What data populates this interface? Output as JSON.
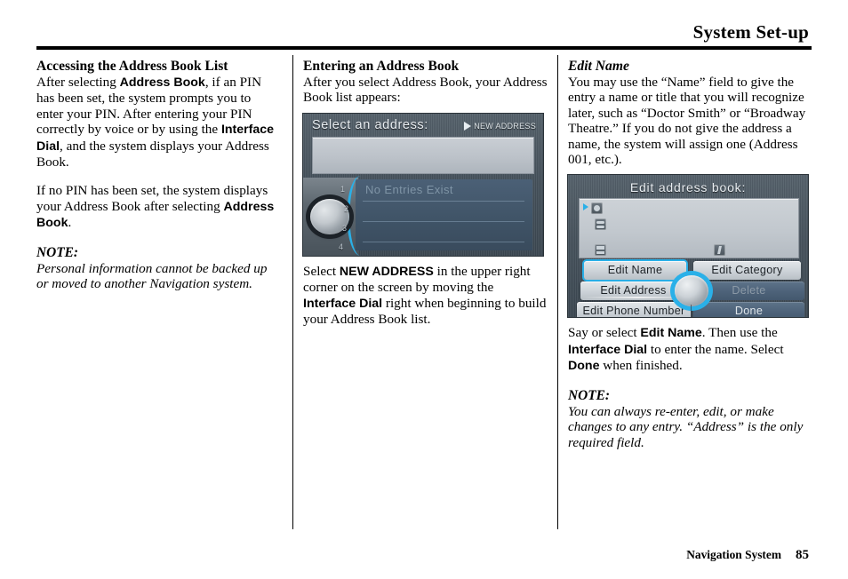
{
  "header": {
    "title": "System Set-up"
  },
  "footer": {
    "book": "Navigation System",
    "page": "85"
  },
  "col1": {
    "heading": "Accessing the Address Book List",
    "p1_a": "After selecting ",
    "p1_b": "Address Book",
    "p1_c": ", if an PIN has been set, the system prompts you to enter your PIN. After entering your PIN correctly by voice or by using the ",
    "p1_d": "Interface Dial",
    "p1_e": ", and the system displays your Address Book.",
    "p2_a": "If no PIN has been set, the system displays your Address Book after selecting ",
    "p2_b": "Address Book",
    "p2_c": ".",
    "note_label": "NOTE:",
    "note_body": "Personal information cannot be backed up or moved to another Navigation system."
  },
  "col2": {
    "heading": "Entering an Address Book",
    "p1": "After you select Address Book, your Address Book list appears:",
    "p2_a": "Select ",
    "p2_b": "NEW ADDRESS",
    "p2_c": " in the upper right corner on the screen by moving the ",
    "p2_d": "Interface Dial",
    "p2_e": " right when beginning to build your Address Book list.",
    "screen": {
      "title": "Select an address:",
      "new_address": "NEW ADDRESS",
      "list_empty": "No Entries Exist",
      "dial_numbers": [
        "1",
        "2",
        "3",
        "4"
      ]
    }
  },
  "col3": {
    "heading": "Edit Name",
    "p1": "You may use the “Name” field to give the entry a name or title that you will recognize later, such as “Doctor Smith” or “Broadway Theatre.” If you do not give the address a name, the system will assign one (Address 001, etc.).",
    "p2_a": "Say or select ",
    "p2_b": "Edit Name",
    "p2_c": ". Then use the ",
    "p2_d": "Interface Dial",
    "p2_e": " to enter the name. Select ",
    "p2_f": "Done",
    "p2_g": " when finished.",
    "note_label": "NOTE:",
    "note_body": "You can always re-enter, edit, or make changes to any entry. “Address” is the only required field.",
    "screen": {
      "title": "Edit address book:",
      "buttons": [
        {
          "label": "Edit Name",
          "state": "selected"
        },
        {
          "label": "Edit Category",
          "state": "normal"
        },
        {
          "label": "Edit Address",
          "state": "normal"
        },
        {
          "label": "Delete",
          "state": "disabled"
        },
        {
          "label": "Edit Phone Number",
          "state": "normal"
        },
        {
          "label": "Done",
          "state": "dark"
        }
      ]
    }
  },
  "colors": {
    "accent_cyan": "#2ab0e8",
    "screen_dark": "#46525c",
    "panel_light": "#c2c8ce",
    "list_blue": "#3f5366"
  }
}
